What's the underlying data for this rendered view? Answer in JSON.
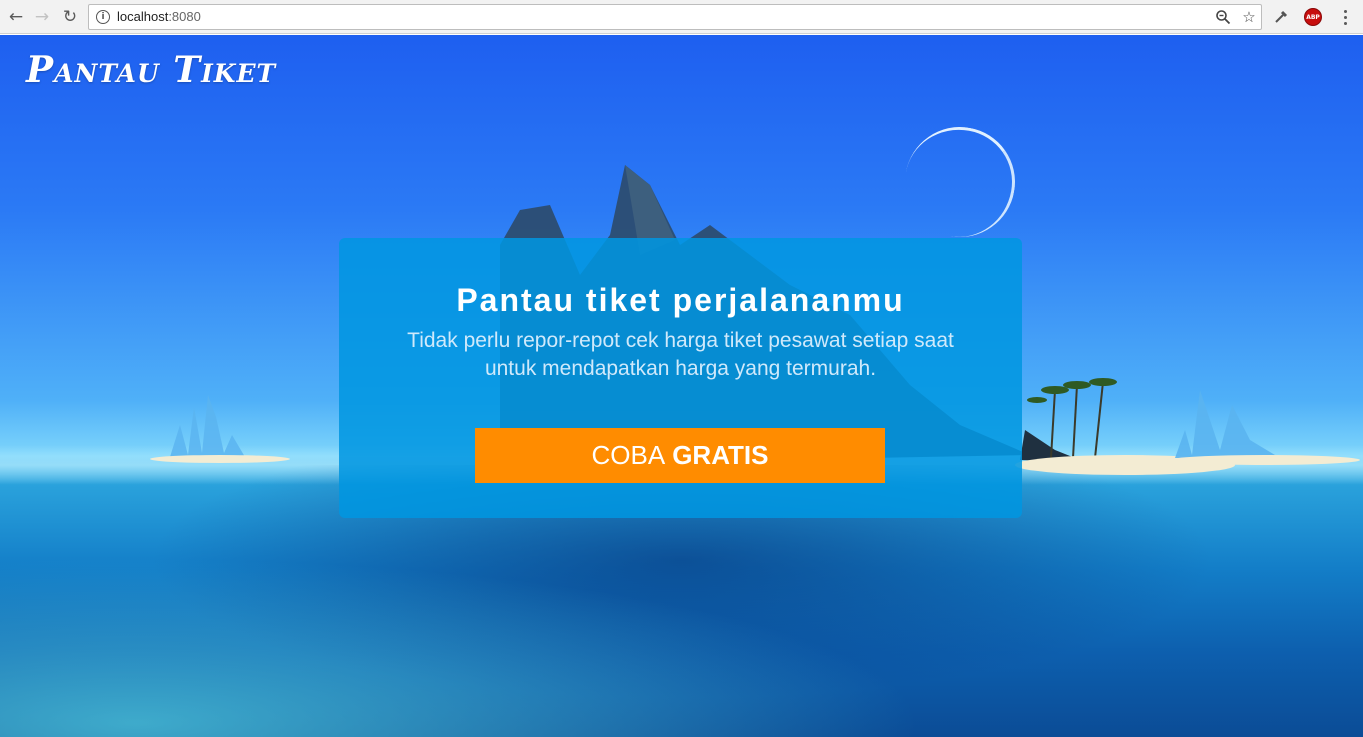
{
  "browser": {
    "url_host": "localhost",
    "url_port": ":8080"
  },
  "site": {
    "brand": "Pantau Tiket"
  },
  "hero": {
    "title": "Pantau tiket perjalananmu",
    "subtitle": "Tidak perlu repor-repot cek harga tiket pesawat setiap saat untuk mendapatkan harga yang termurah.",
    "cta_prefix": "COBA",
    "cta_bold": "GRATIS"
  },
  "colors": {
    "cta": "#ff8c00",
    "card": "#0096e1",
    "sky": "#1e5ff0"
  }
}
